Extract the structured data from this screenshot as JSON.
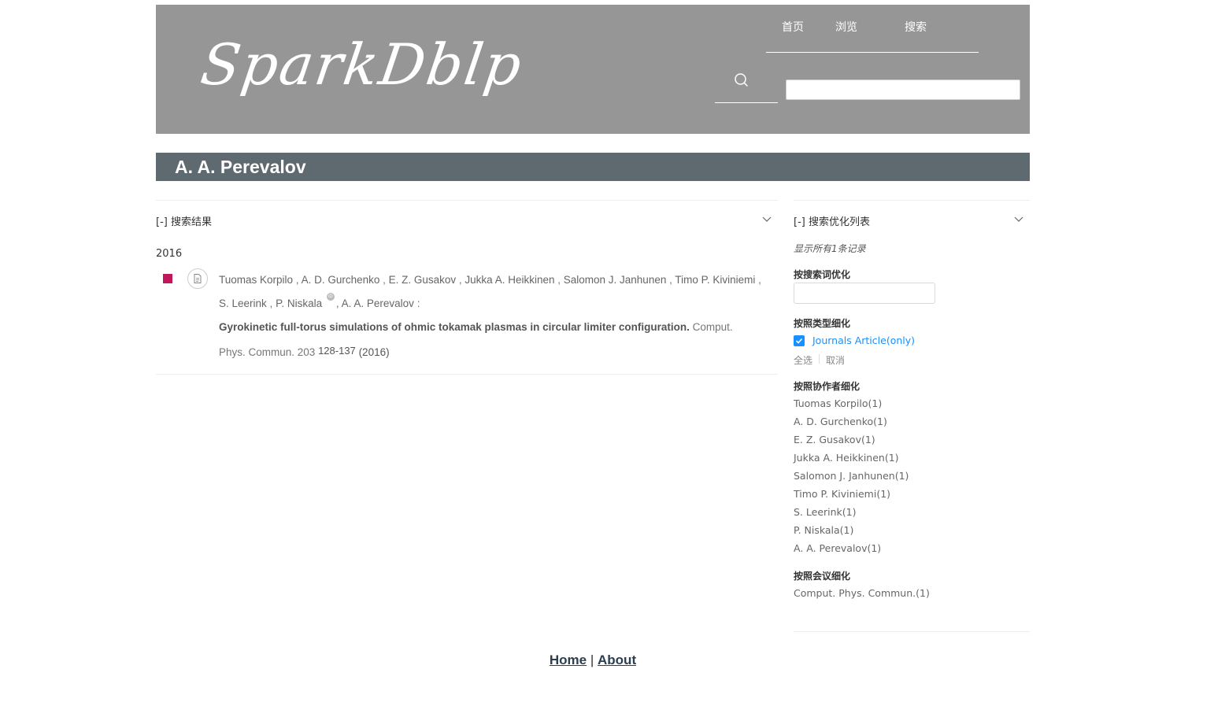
{
  "header": {
    "logo_text": "SparkDblp",
    "nav": [
      "首页",
      "浏览",
      "搜索"
    ],
    "search_placeholder": ""
  },
  "person": {
    "name": "A. A. Perevalov"
  },
  "results_panel": {
    "title": "[-] 搜索结果",
    "year": "2016",
    "publication": {
      "authors": [
        "Tuomas Korpilo",
        "A. D. Gurchenko",
        "E. Z. Gusakov",
        "Jukka A. Heikkinen",
        "Salomon J. Janhunen",
        "Timo P. Kiviniemi",
        "S. Leerink",
        "P. Niskala",
        "A. A. Perevalov"
      ],
      "title": "Gyrokinetic full-torus simulations of ohmic tokamak plasmas in circular limiter configuration.",
      "venue": "Comput. Phys. Commun. 203",
      "pages": "128-137",
      "year": "(2016)",
      "mark_color": "#c2185b"
    }
  },
  "refine_panel": {
    "title": "[-] 搜索优化列表",
    "summary": "显示所有1条记录",
    "by_keyword_label": "按搜索词优化",
    "by_type_label": "按照类型细化",
    "type_option": "Journals Article(only)",
    "type_checked": true,
    "select_all": "全选",
    "cancel": "取消",
    "by_coauthor_label": "按照协作者细化",
    "coauthors": [
      "Tuomas Korpilo(1)",
      "A. D. Gurchenko(1)",
      "E. Z. Gusakov(1)",
      "Jukka A. Heikkinen(1)",
      "Salomon J. Janhunen(1)",
      "Timo P. Kiviniemi(1)",
      "S. Leerink(1)",
      "P. Niskala(1)",
      "A. A. Perevalov(1)"
    ],
    "by_venue_label": "按照会议细化",
    "venues": [
      "Comput. Phys. Commun.(1)"
    ]
  },
  "footer": {
    "home": "Home",
    "separator": "|",
    "about": "About"
  },
  "colors": {
    "header_bg": "#969696",
    "name_bar_bg": "#5f6a70",
    "accent": "#1890ff"
  }
}
